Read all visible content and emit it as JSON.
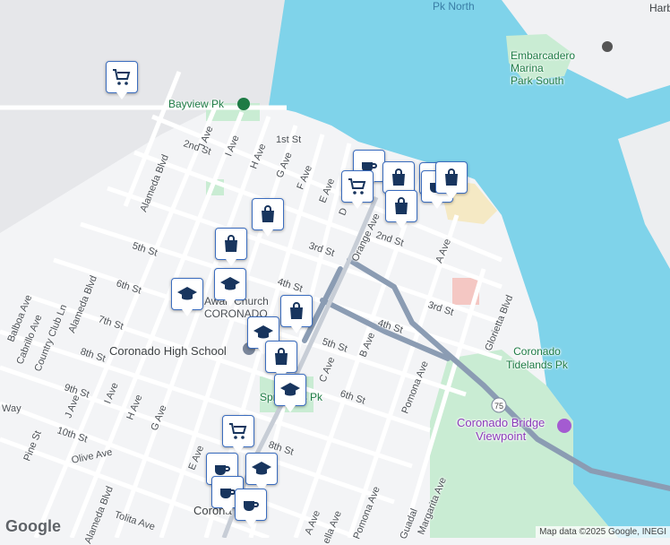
{
  "map": {
    "labels": {
      "pk_north": "Pk North",
      "harbor": "Harb",
      "embarcadero": "Embarcadero\nMarina\nPark South",
      "bayview": "Bayview Pk",
      "coronado_high": "Coronado High School",
      "tidelands": "Coronado\nTidelands Pk",
      "bridge_viewpoint": "Coronado Bridge\nViewpoint",
      "spreckels": "Spreckels Pk",
      "church": "Awan Church",
      "coronado_small": "CORONADO",
      "coronado_town": "Corona",
      "route": "75"
    },
    "streets": {
      "st1": "1st St",
      "st2a": "2nd St",
      "st2b": "2nd St",
      "st3a": "3rd St",
      "st3b": "3rd St",
      "st4a": "4th St",
      "st4b": "4th St",
      "st5a": "5th St",
      "st5b": "5th St",
      "st6a": "6th St",
      "st6b": "6th St",
      "st7": "7th St",
      "st8a": "8th St",
      "st8b": "8th St",
      "st9": "9th St",
      "st10": "10th St",
      "jave": "J Ave",
      "iave": "I Ave",
      "have": "H Ave",
      "gave": "G Ave",
      "fave": "F Ave",
      "eave": "E Ave",
      "dave": "D",
      "aave": "A Ave",
      "bave": "B Ave",
      "cave": "C Ave",
      "orange": "Orange Ave",
      "alameda1": "Alameda Blvd",
      "alameda2": "Alameda Blvd",
      "alameda3": "Alameda Blvd",
      "glorietta": "Glorietta Blvd",
      "pomona1": "Pomona Ave",
      "pomona2": "Pomona Ave",
      "margarita": "Margarita Ave",
      "guadal": "Guadal",
      "balboa": "Balboa Ave",
      "cabrillo": "Cabrillo Ave",
      "country": "Country Club Ln",
      "pine": "Pine St",
      "olive": "Olive Ave",
      "tolita": "Tolita Ave",
      "way": "Way",
      "jave2": "J Ave",
      "iave2": "I Ave",
      "have2": "H Ave",
      "gave2": "G Ave",
      "eave2": "E Ave",
      "aave2": "A Ave",
      "ella": "ella Ave"
    },
    "pins": [
      {
        "type": "cart",
        "icon": "shopping-cart-icon"
      },
      {
        "type": "bag",
        "icon": "shopping-bag-icon"
      },
      {
        "type": "bag",
        "icon": "shopping-bag-icon"
      },
      {
        "type": "school",
        "icon": "graduation-cap-icon"
      },
      {
        "type": "school",
        "icon": "graduation-cap-icon"
      },
      {
        "type": "bag",
        "icon": "shopping-bag-icon"
      },
      {
        "type": "school",
        "icon": "graduation-cap-icon"
      },
      {
        "type": "bag",
        "icon": "shopping-bag-icon"
      },
      {
        "type": "school",
        "icon": "graduation-cap-icon"
      },
      {
        "type": "cafe",
        "icon": "restaurant-icon"
      },
      {
        "type": "bag",
        "icon": "shopping-bag-icon"
      },
      {
        "type": "cart",
        "icon": "shopping-cart-icon"
      },
      {
        "type": "bag",
        "icon": "shopping-bag-icon"
      },
      {
        "type": "parking",
        "icon": "parking-icon"
      },
      {
        "type": "cafe",
        "icon": "restaurant-icon"
      },
      {
        "type": "bag",
        "icon": "shopping-bag-icon"
      },
      {
        "type": "cart",
        "icon": "shopping-cart-icon"
      },
      {
        "type": "cafe",
        "icon": "coffee-cup-icon"
      },
      {
        "type": "school",
        "icon": "graduation-cap-icon"
      },
      {
        "type": "cafe",
        "icon": "coffee-cup-icon"
      },
      {
        "type": "cafe",
        "icon": "coffee-cup-icon"
      }
    ],
    "attribution": "Map data ©2025 Google, INEGI",
    "logo": "Google",
    "colors": {
      "water": "#7fd3ea",
      "park": "#c9ecd3",
      "land": "#f3f4f6",
      "road": "#ffffff",
      "highway": "#8b9cb3",
      "pin_border": "#3b6dbf",
      "icon": "#18355e"
    }
  }
}
